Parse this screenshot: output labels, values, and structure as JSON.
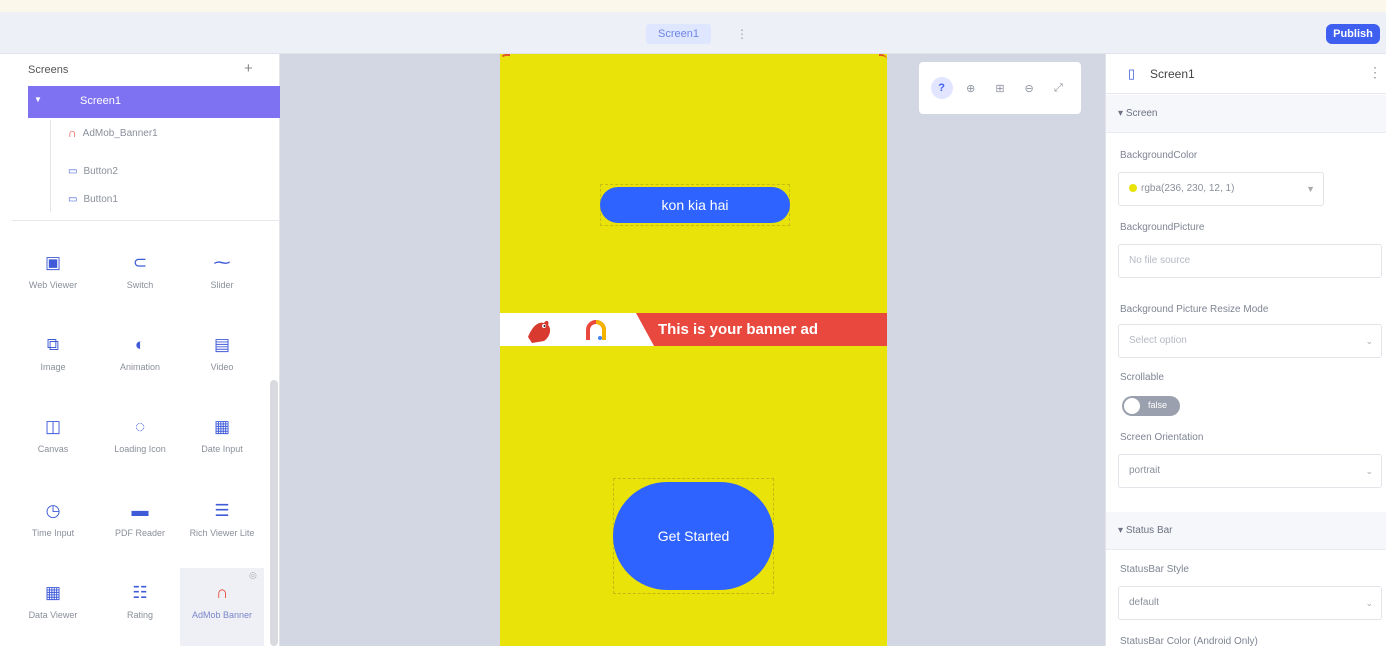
{
  "header": {
    "screen_tab": "Screen1",
    "more": "⋮",
    "publish": "Publish"
  },
  "screens": {
    "title": "Screens",
    "add": "+",
    "screen": "Screen1",
    "nodes": [
      "AdMob_Banner1",
      "Button2",
      "Button1"
    ]
  },
  "components": [
    {
      "label": "Web Viewer",
      "icon": "web-viewer-icon"
    },
    {
      "label": "Switch",
      "icon": "switch-icon"
    },
    {
      "label": "Slider",
      "icon": "slider-icon"
    },
    {
      "label": "Image",
      "icon": "image-icon"
    },
    {
      "label": "Animation",
      "icon": "animation-icon"
    },
    {
      "label": "Video",
      "icon": "video-icon"
    },
    {
      "label": "Canvas",
      "icon": "canvas-icon"
    },
    {
      "label": "Loading Icon",
      "icon": "loading-icon"
    },
    {
      "label": "Date Input",
      "icon": "date-input-icon"
    },
    {
      "label": "Time Input",
      "icon": "time-input-icon"
    },
    {
      "label": "PDF Reader",
      "icon": "pdf-reader-icon"
    },
    {
      "label": "Rich Viewer Lite",
      "icon": "rich-viewer-icon"
    },
    {
      "label": "Data Viewer",
      "icon": "data-viewer-icon"
    },
    {
      "label": "Rating",
      "icon": "rating-icon"
    },
    {
      "label": "AdMob Banner",
      "icon": "admob-icon"
    }
  ],
  "canvas": {
    "top_button": "kon kia hai",
    "banner_text": "This is your banner ad",
    "bottom_button": "Get Started"
  },
  "toolbar": [
    "?",
    "⊕",
    "⊞",
    "⊖",
    "⤢"
  ],
  "properties": {
    "title": "Screen1",
    "section_screen": "Screen",
    "bg_color_label": "BackgroundColor",
    "bg_color_value": "rgba(236, 230, 12, 1)",
    "bg_picture_label": "BackgroundPicture",
    "bg_picture_placeholder": "No file source",
    "bg_mode_label": "Background Picture Resize Mode",
    "bg_mode_placeholder": "Select option",
    "scrollable_label": "Scrollable",
    "scrollable_value": "false",
    "orientation_label": "Screen Orientation",
    "orientation_value": "portrait",
    "section_status": "Status Bar",
    "status_style_label": "StatusBar Style",
    "status_style_value": "default",
    "status_color_label": "StatusBar Color (Android Only)"
  },
  "colors": {
    "accent": "#3f5ff0",
    "screen_bg": "#e9e30a",
    "button": "#2f63ff",
    "banner_red": "#e8483d",
    "tree_selected": "#7f72f2"
  }
}
